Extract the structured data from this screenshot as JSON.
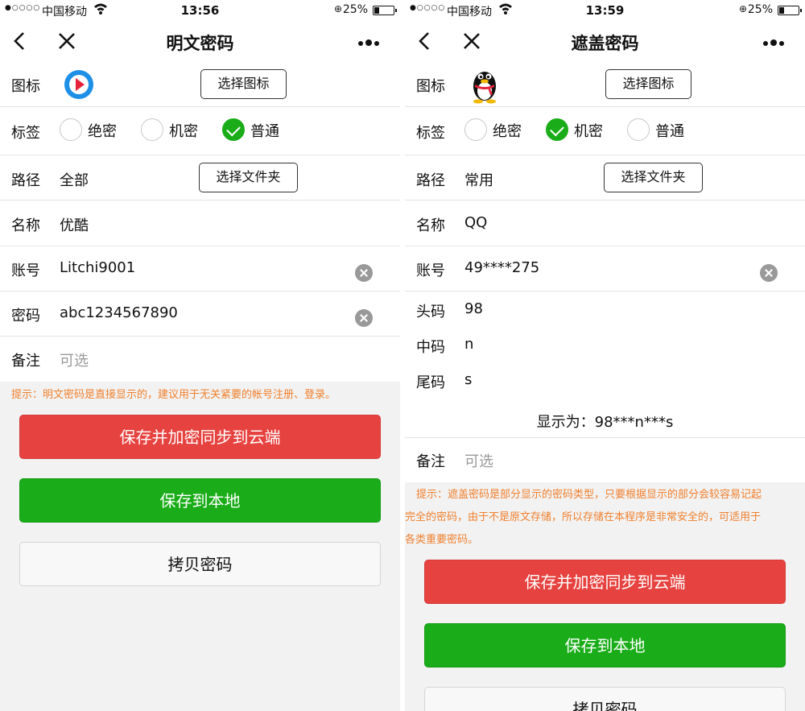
{
  "status_bar": {
    "left": {
      "carrier": "中国移动",
      "time": "13:56",
      "battery_pct": "25%",
      "battery_level": 0.25
    },
    "right": {
      "carrier": "中国移动",
      "time": "13:59",
      "battery_pct": "25%",
      "battery_level": 0.25
    }
  },
  "left": {
    "title": "明文密码",
    "icon_label": "图标",
    "choose_icon": "选择图标",
    "tag_label": "标签",
    "tags": [
      {
        "label": "绝密",
        "checked": false
      },
      {
        "label": "机密",
        "checked": false
      },
      {
        "label": "普通",
        "checked": true
      }
    ],
    "path_label": "路径",
    "path_value": "全部",
    "choose_folder": "选择文件夹",
    "name_label": "名称",
    "name_value": "优酷",
    "account_label": "账号",
    "account_value": "Litchi9001",
    "password_label": "密码",
    "password_value": "abc1234567890",
    "note_label": "备注",
    "note_placeholder": "可选",
    "hint": "提示：明文密码是直接显示的，建议用于无关紧要的帐号注册、登录。",
    "save_cloud": "保存并加密同步到云端",
    "save_local": "保存到本地",
    "copy": "拷贝密码",
    "icon_name": "youku-icon"
  },
  "right": {
    "title": "遮盖密码",
    "icon_label": "图标",
    "choose_icon": "选择图标",
    "tag_label": "标签",
    "tags": [
      {
        "label": "绝密",
        "checked": false
      },
      {
        "label": "机密",
        "checked": true
      },
      {
        "label": "普通",
        "checked": false
      }
    ],
    "path_label": "路径",
    "path_value": "常用",
    "choose_folder": "选择文件夹",
    "name_label": "名称",
    "name_value": "QQ",
    "account_label": "账号",
    "account_value": "49****275",
    "head_label": "头码",
    "head_value": "98",
    "mid_label": "中码",
    "mid_value": "n",
    "tail_label": "尾码",
    "tail_value": "s",
    "display_text": "显示为：98***n***s",
    "note_label": "备注",
    "note_placeholder": "可选",
    "hint_lines": [
      "提示：遮盖密码是部分显示的密码类型，只要根据显示的部分会较容易记起",
      "完全的密码，由于不是原文存储，所以存储在本程序是非常安全的，可适用于",
      "各类重要密码。"
    ],
    "save_cloud": "保存并加密同步到云端",
    "save_local": "保存到本地",
    "copy": "拷贝密码",
    "icon_name": "qq-penguin-icon"
  },
  "colors": {
    "green": "#1aad19",
    "red": "#e64340",
    "hint_orange": "#f0802e",
    "page_bg": "#f2f2f2"
  }
}
